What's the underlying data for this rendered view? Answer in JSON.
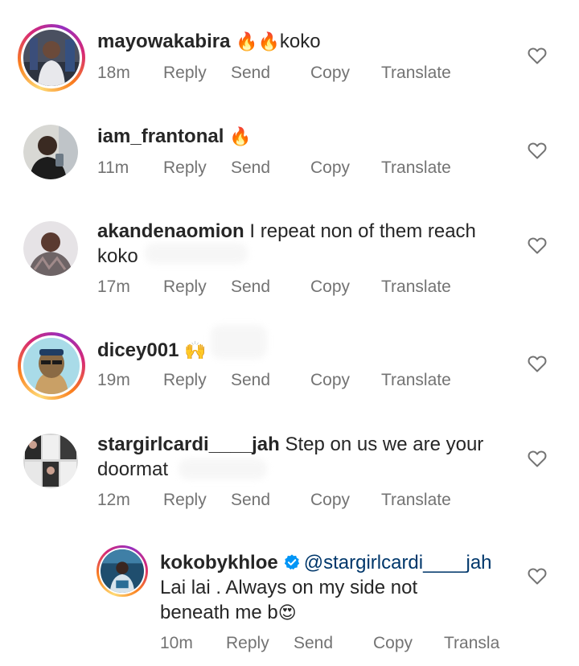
{
  "comments": [
    {
      "username": "mayowakabira",
      "emoji": "🔥🔥",
      "text": "koko",
      "time": "18m",
      "actions": {
        "reply": "Reply",
        "send": "Send",
        "copy": "Copy",
        "translate": "Translate"
      }
    },
    {
      "username": "iam_frantonal",
      "emoji": "🔥",
      "text": "",
      "time": "11m",
      "actions": {
        "reply": "Reply",
        "send": "Send",
        "copy": "Copy",
        "translate": "Translate"
      }
    },
    {
      "username": "akandenaomion",
      "text": "I repeat non of them reach",
      "text_line2": "koko",
      "time": "17m",
      "actions": {
        "reply": "Reply",
        "send": "Send",
        "copy": "Copy",
        "translate": "Translate"
      }
    },
    {
      "username": "dicey001",
      "emoji": "🙌",
      "text": "",
      "time": "19m",
      "actions": {
        "reply": "Reply",
        "send": "Send",
        "copy": "Copy",
        "translate": "Translate"
      }
    },
    {
      "username": "stargirlcardi____jah",
      "text": "Step on us we are your",
      "text_line2": "doormat",
      "time": "12m",
      "actions": {
        "reply": "Reply",
        "send": "Send",
        "copy": "Copy",
        "translate": "Translate"
      }
    },
    {
      "username": "kokobykhloe",
      "mention": "@stargirlcardi____jah",
      "text": "Lai lai . Always on my side not",
      "text_line2": "beneath me b",
      "emoji": "😍",
      "time": "10m",
      "actions": {
        "reply": "Reply",
        "send": "Send",
        "copy": "Copy",
        "translate": "Transla"
      }
    }
  ],
  "colors": {
    "primary_text": "#262626",
    "secondary_text": "#737373",
    "mention": "#00376b",
    "verified_badge": "#0095f6",
    "story_ring": "#d62976"
  },
  "icons": {
    "like": "heart-outline-icon",
    "verified": "verified-badge-icon"
  }
}
